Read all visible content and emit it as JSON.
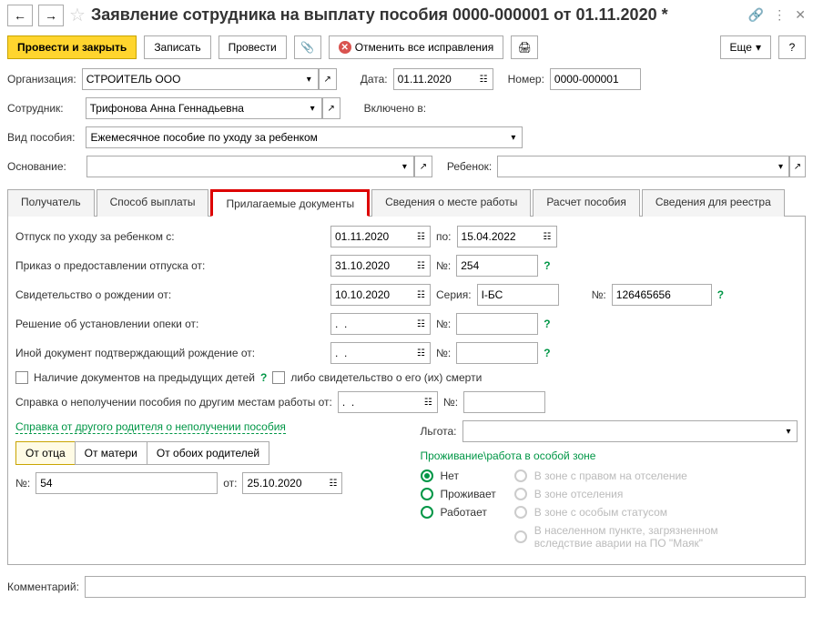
{
  "header": {
    "title": "Заявление сотрудника на выплату пособия 0000-000001 от 01.11.2020 *"
  },
  "toolbar": {
    "post_close": "Провести и закрыть",
    "save": "Записать",
    "post": "Провести",
    "cancel_corrections": "Отменить все исправления",
    "more": "Еще"
  },
  "form": {
    "org_label": "Организация:",
    "org_value": "СТРОИТЕЛЬ ООО",
    "date_label": "Дата:",
    "date_value": "01.11.2020",
    "number_label": "Номер:",
    "number_value": "0000-000001",
    "employee_label": "Сотрудник:",
    "employee_value": "Трифонова Анна Геннадьевна",
    "included_label": "Включено в:",
    "benefit_type_label": "Вид пособия:",
    "benefit_type_value": "Ежемесячное пособие по уходу за ребенком",
    "basis_label": "Основание:",
    "child_label": "Ребенок:"
  },
  "tabs": {
    "t0": "Получатель",
    "t1": "Способ выплаты",
    "t2": "Прилагаемые документы",
    "t3": "Сведения о месте работы",
    "t4": "Расчет пособия",
    "t5": "Сведения для реестра"
  },
  "docs": {
    "leave_from_label": "Отпуск по уходу за ребенком с:",
    "leave_from": "01.11.2020",
    "leave_to_label": "по:",
    "leave_to": "15.04.2022",
    "order_label": "Приказ о предоставлении отпуска от:",
    "order_date": "31.10.2020",
    "order_no_label": "№:",
    "order_no": "254",
    "birth_cert_label": "Свидетельство о рождении от:",
    "birth_cert_date": "10.10.2020",
    "series_label": "Серия:",
    "series_value": "I-БС",
    "birth_no_label": "№:",
    "birth_no": "126465656",
    "custody_label": "Решение об установлении опеки от:",
    "custody_date": ".  .",
    "custody_no_label": "№:",
    "other_doc_label": "Иной документ подтверждающий рождение от:",
    "other_doc_date": ".  .",
    "other_doc_no_label": "№:",
    "prev_children_label": "Наличие документов на предыдущих детей",
    "death_cert_label": "либо свидетельство о его (их) смерти",
    "non_receipt_label": "Справка о неполучении пособия по другим местам работы от:",
    "non_receipt_date": ".  .",
    "non_receipt_no_label": "№:",
    "other_parent_link": "Справка от другого родителя о неполучении пособия",
    "from_father": "От отца",
    "from_mother": "От матери",
    "from_both": "От обоих родителей",
    "ref_no_label": "№:",
    "ref_no": "54",
    "ref_date_label": "от:",
    "ref_date": "25.10.2020",
    "privilege_label": "Льгота:",
    "zone_title": "Проживание\\работа в особой зоне",
    "zone_no": "Нет",
    "zone_lives": "Проживает",
    "zone_works": "Работает",
    "zone_reloc": "В зоне с правом на отселение",
    "zone_otsel": "В зоне отселения",
    "zone_status": "В зоне с особым статусом",
    "zone_mayak": "В населенном пункте, загрязненном вследствие аварии на ПО \"Маяк\""
  },
  "footer": {
    "comment_label": "Комментарий:"
  }
}
